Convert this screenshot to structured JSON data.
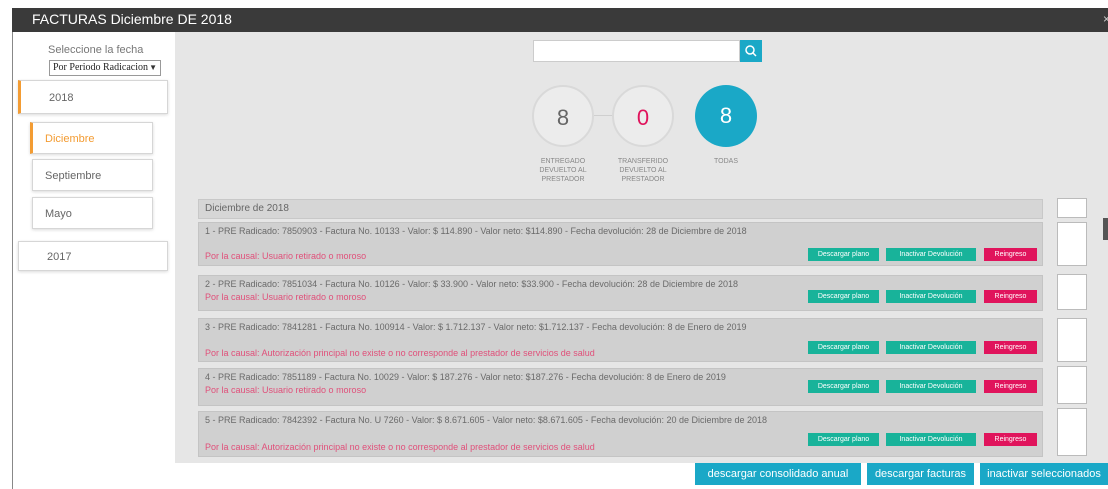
{
  "window": {
    "title": "FACTURAS Diciembre DE 2018",
    "close": "×"
  },
  "sidebar": {
    "select_label": "Seleccione la fecha",
    "select_value": "Por Periodo Radicacion",
    "years": [
      {
        "label": "2018"
      },
      {
        "label": "2017"
      }
    ],
    "months": [
      {
        "label": "Diciembre"
      },
      {
        "label": "Septiembre"
      },
      {
        "label": "Mayo"
      }
    ]
  },
  "search": {
    "placeholder": "",
    "value": ""
  },
  "counters": [
    {
      "value": "8",
      "label": "ENTREGADO DEVUELTO AL PRESTADOR"
    },
    {
      "value": "0",
      "label": "TRANSFERIDO DEVUELTO AL PRESTADOR"
    },
    {
      "value": "8",
      "label": "TODAS"
    }
  ],
  "list": {
    "month_header": "Diciembre de 2018",
    "rows": [
      {
        "text": "1 - PRE Radicado:   7850903 - Factura No. 10133 - Valor: $ 114.890 - Valor neto: $114.890 - Fecha devolución: 28 de Diciembre de 2018",
        "reason": "Por la causal: Usuario retirado o moroso"
      },
      {
        "text": "2 - PRE Radicado:   7851034 - Factura No. 10126 - Valor: $ 33.900 - Valor neto: $33.900 - Fecha devolución: 28 de Diciembre de 2018",
        "reason": "Por la causal: Usuario retirado o moroso"
      },
      {
        "text": "3 - PRE Radicado:   7841281 - Factura No. 100914 - Valor: $ 1.712.137 - Valor neto: $1.712.137 - Fecha devolución: 8 de Enero de 2019",
        "reason": "Por la causal: Autorización principal no existe o no corresponde al prestador de servicios de salud"
      },
      {
        "text": "4 - PRE Radicado:   7851189 - Factura No. 10029 - Valor: $ 187.276 - Valor neto: $187.276 - Fecha devolución: 8 de Enero de 2019",
        "reason": "Por la causal: Usuario retirado o moroso"
      },
      {
        "text": "5 - PRE Radicado:   7842392 - Factura No. U 7260 - Valor: $ 8.671.605 - Valor neto: $8.671.605 - Fecha devolución: 20 de Diciembre de 2018",
        "reason": "Por la causal: Autorización principal no existe o no corresponde al prestador de servicios de salud"
      }
    ],
    "buttons": {
      "download": "Descargar plano",
      "inactivate": "Inactivar Devolución",
      "reingreso": "Reingreso"
    }
  },
  "footer": {
    "download_annual": "descargar consolidado anual",
    "download_invoices": "descargar facturas",
    "inactivate_selected": "inactivar seleccionados"
  },
  "colors": {
    "accent": "#1aa8c7",
    "active_orange": "#f39c33",
    "green": "#18b39a",
    "red": "#e0145c",
    "reason_pink": "#e0507a"
  }
}
